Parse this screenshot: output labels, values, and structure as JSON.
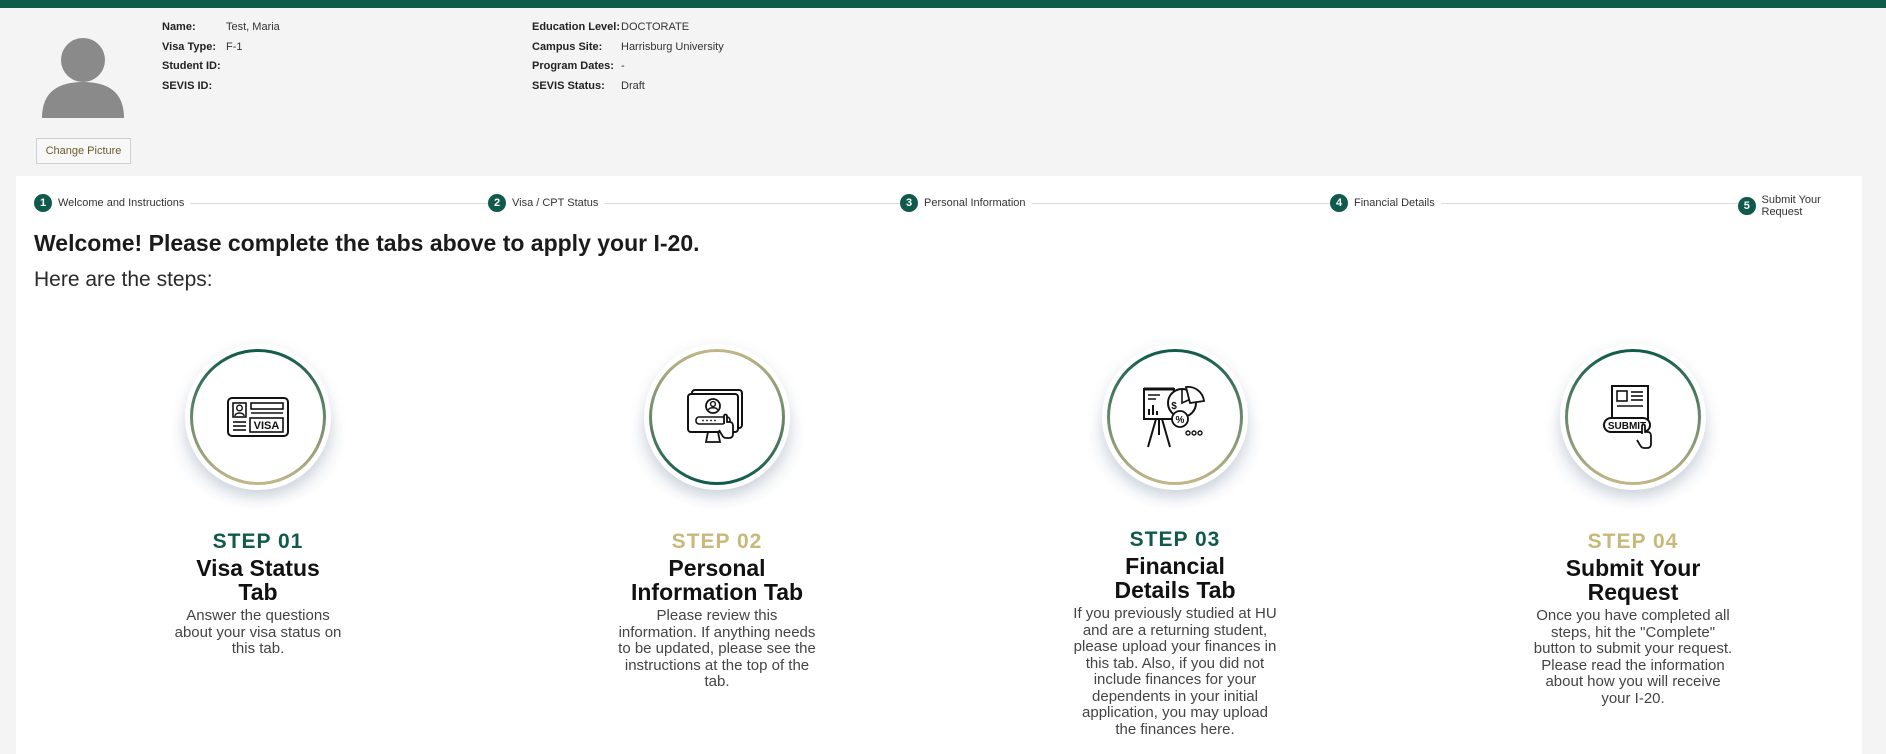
{
  "profile": {
    "name_label": "Name:",
    "name": "Test, Maria",
    "visa_label": "Visa Type:",
    "visa": "F-1",
    "student_id_label": "Student ID:",
    "student_id": "",
    "sevis_id_label": "SEVIS ID:",
    "sevis_id": "",
    "education_label": "Education Level:",
    "education": "DOCTORATE",
    "campus_label": "Campus Site:",
    "campus": "Harrisburg University",
    "program_dates_label": "Program Dates:",
    "program_dates": "-",
    "sevis_status_label": "SEVIS Status:",
    "sevis_status": "Draft",
    "change_picture": "Change Picture"
  },
  "tabs": [
    {
      "num": "1",
      "label": "Welcome and Instructions"
    },
    {
      "num": "2",
      "label": "Visa / CPT Status"
    },
    {
      "num": "3",
      "label": "Personal Information"
    },
    {
      "num": "4",
      "label": "Financial Details"
    },
    {
      "num": "5",
      "label": "Submit Your Request"
    }
  ],
  "welcome": "Welcome! Please complete the tabs above to apply your I-20.",
  "steps_heading": "Here are the steps:",
  "steps": [
    {
      "num": "STEP 01",
      "title": "Visa Status Tab",
      "desc": "Answer the questions about your visa status on this tab.",
      "icon": "visa-card-icon"
    },
    {
      "num": "STEP 02",
      "title": "Personal Information Tab",
      "desc": "Please review this information. If anything needs to be updated, please see the instructions at the top of the tab.",
      "icon": "profile-monitor-icon"
    },
    {
      "num": "STEP 03",
      "title": "Financial Details Tab",
      "desc": "If you previously studied at HU and are a returning student, please upload your finances in this tab. Also, if you did not include finances for your dependents in your initial application, you may upload the finances here.",
      "icon": "finance-presentation-icon"
    },
    {
      "num": "STEP 04",
      "title": "Submit Your Request",
      "desc": "Once you have completed all steps, hit the \"Complete\" button to submit your request. Please read the information about how you will receive your I-20.",
      "icon": "submit-click-icon"
    }
  ],
  "icon_text": {
    "visa": "VISA",
    "submit": "SUBMIT",
    "dollar": "$",
    "percent": "%"
  },
  "colors": {
    "primary": "#0f5a4a",
    "gold": "#c8b87a"
  }
}
